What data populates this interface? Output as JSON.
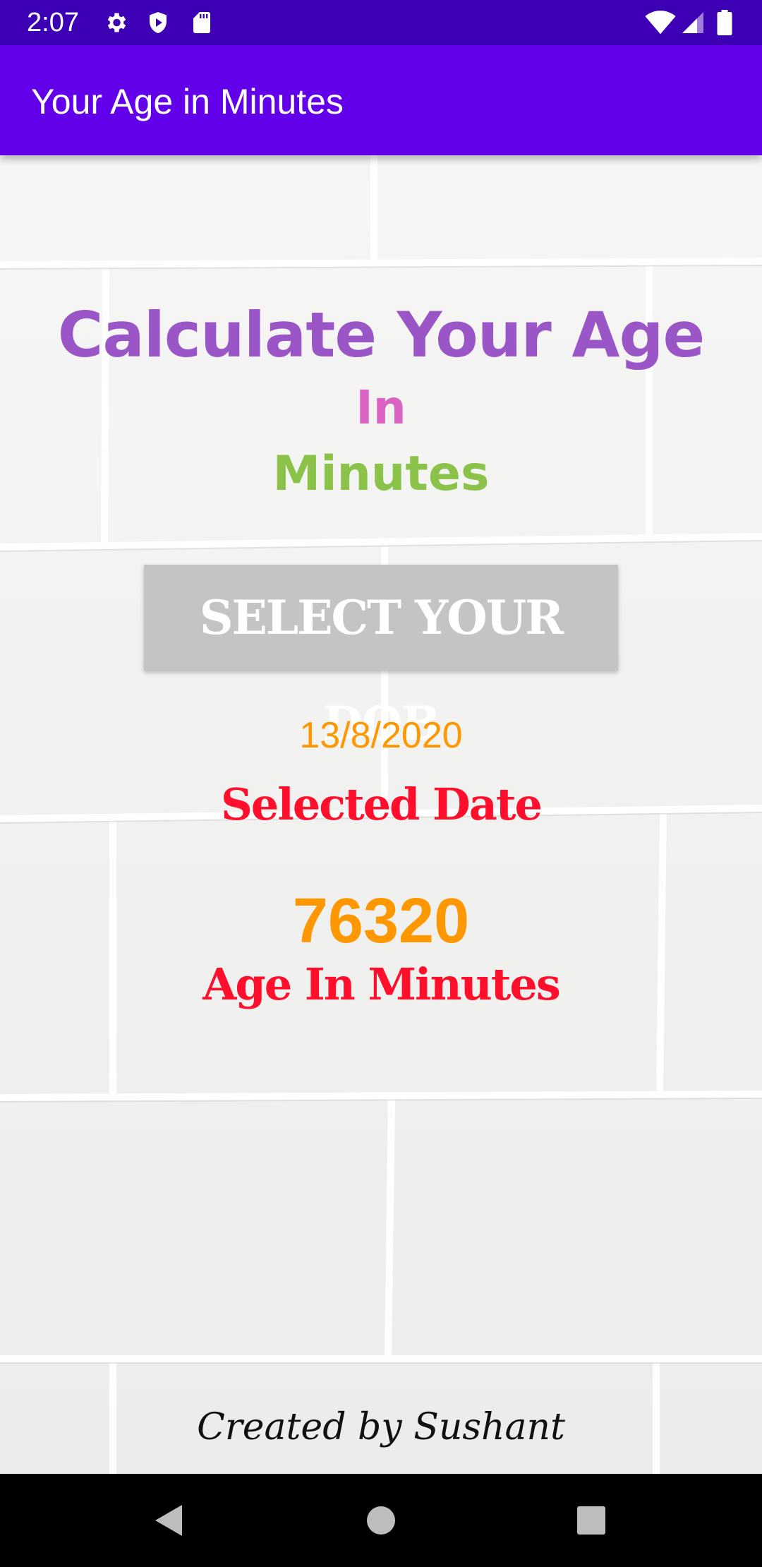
{
  "status_bar": {
    "time": "2:07",
    "icons": [
      "settings-icon",
      "shield-icon",
      "sd-card-icon",
      "wifi-icon",
      "signal-icon",
      "battery-icon"
    ]
  },
  "app_bar": {
    "title": "Your Age in Minutes",
    "color": "#6200ea"
  },
  "main": {
    "headline_line1": "Calculate Your Age",
    "headline_line2": "In",
    "headline_line3": "Minutes",
    "select_button_label": "SELECT YOUR DOB",
    "selected_date_value": "13/8/2020",
    "selected_date_label": "Selected Date",
    "age_in_minutes_value": "76320",
    "age_in_minutes_label": "Age In Minutes",
    "footer_credit": "Created by Sushant"
  },
  "colors": {
    "headline_purple": "#9a55c6",
    "headline_pink": "#d964c1",
    "headline_green": "#8bc34a",
    "accent_orange": "#ff9800",
    "accent_red": "#ff0f2b",
    "button_gray": "#c4c5c3"
  },
  "nav_bar": {
    "buttons": [
      "back-icon",
      "home-icon",
      "recents-icon"
    ]
  }
}
